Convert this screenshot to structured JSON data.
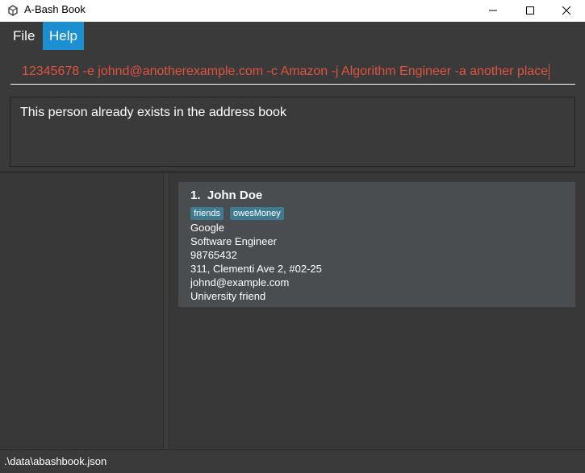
{
  "window": {
    "title": "A-Bash Book",
    "icon": "app-logo-icon",
    "controls": [
      "minimize-icon",
      "maximize-icon",
      "close-icon"
    ]
  },
  "menu": {
    "items": [
      {
        "label": "File"
      },
      {
        "label": "Help"
      }
    ],
    "active_color": "#1b8fcf"
  },
  "command": {
    "value": "12345678 -e johnd@anotherexample.com -c Amazon -j Algorithm Engineer -a another place",
    "text_color": "#e0533f"
  },
  "result": {
    "message": "This person already exists in the address book"
  },
  "person_list": [
    {
      "index": "1.",
      "name": "John Doe",
      "tags": [
        "friends",
        "owesMoney"
      ],
      "company": "Google",
      "job": "Software Engineer",
      "phone": "98765432",
      "address": "311, Clementi Ave 2, #02-25",
      "email": "johnd@example.com",
      "remark": "University friend"
    }
  ],
  "status": {
    "file_path": ".\\data\\abashbook.json"
  }
}
